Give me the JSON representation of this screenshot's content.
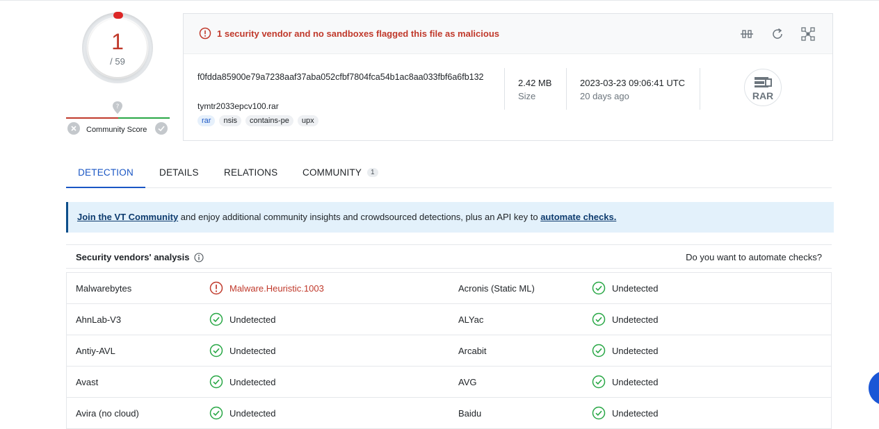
{
  "score": {
    "detections": "1",
    "total": "/ 59"
  },
  "community": {
    "label": "Community Score",
    "marker": "?"
  },
  "alert": {
    "text": "1 security vendor and no sandboxes flagged this file as malicious"
  },
  "file": {
    "hash": "f0fdda85900e79a7238aaf37aba052cfbf7804fca54b1ac8aa033fbf6a6fb132",
    "name": "tymtr2033epcv100.rar",
    "tags": [
      "rar",
      "nsis",
      "contains-pe",
      "upx"
    ],
    "size_value": "2.42 MB",
    "size_label": "Size",
    "date_value": "2023-03-23 09:06:41 UTC",
    "date_label": "20 days ago",
    "type_icon_label": "RAR"
  },
  "tabs": [
    {
      "label": "DETECTION"
    },
    {
      "label": "DETAILS"
    },
    {
      "label": "RELATIONS"
    },
    {
      "label": "COMMUNITY",
      "badge": "1"
    }
  ],
  "banner": {
    "link1": "Join the VT Community",
    "middle": " and enjoy additional community insights and crowdsourced detections, plus an API key to ",
    "link2": "automate checks."
  },
  "vendors_header": {
    "title": "Security vendors' analysis",
    "right": "Do you want to automate checks?"
  },
  "vendors": [
    {
      "left_name": "Malwarebytes",
      "left_result": "Malware.Heuristic.1003",
      "left_status": "malicious",
      "right_name": "Acronis (Static ML)",
      "right_result": "Undetected",
      "right_status": "undetected"
    },
    {
      "left_name": "AhnLab-V3",
      "left_result": "Undetected",
      "left_status": "undetected",
      "right_name": "ALYac",
      "right_result": "Undetected",
      "right_status": "undetected"
    },
    {
      "left_name": "Antiy-AVL",
      "left_result": "Undetected",
      "left_status": "undetected",
      "right_name": "Arcabit",
      "right_result": "Undetected",
      "right_status": "undetected"
    },
    {
      "left_name": "Avast",
      "left_result": "Undetected",
      "left_status": "undetected",
      "right_name": "AVG",
      "right_result": "Undetected",
      "right_status": "undetected"
    },
    {
      "left_name": "Avira (no cloud)",
      "left_result": "Undetected",
      "left_status": "undetected",
      "right_name": "Baidu",
      "right_result": "Undetected",
      "right_status": "undetected"
    }
  ],
  "colors": {
    "malicious": "#c0392b",
    "undetected": "#28a745",
    "accent": "#1a56c4"
  }
}
